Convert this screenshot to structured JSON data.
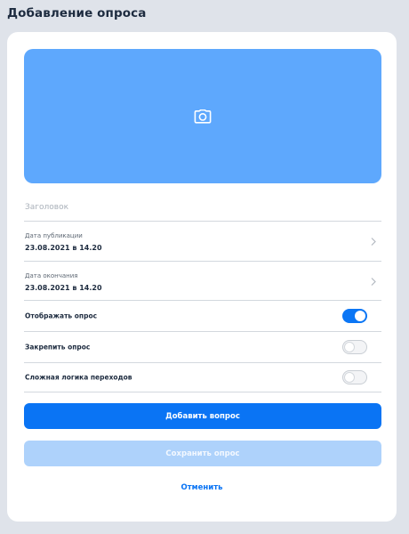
{
  "page": {
    "title": "Добавление опроса"
  },
  "cover": {
    "icon": "camera-icon"
  },
  "form": {
    "title_placeholder": "Заголовок",
    "title_value": "",
    "publish_date": {
      "label": "Дата публикации",
      "value": "23.08.2021 в 14.20"
    },
    "end_date": {
      "label": "Дата окончания",
      "value": "23.08.2021 в 14.20"
    },
    "toggles": [
      {
        "label": "Отображать опрос",
        "on": true
      },
      {
        "label": "Закрепить опрос",
        "on": false
      },
      {
        "label": "Сложная логика переходов",
        "on": false
      }
    ]
  },
  "actions": {
    "add_question": "Добавить вопрос",
    "save_poll": "Сохранить опрос",
    "cancel": "Отменить"
  },
  "colors": {
    "accent": "#0a74f4",
    "cover": "#5ea8fd",
    "disabled": "#aed2fb",
    "background": "#dfe3ea"
  }
}
